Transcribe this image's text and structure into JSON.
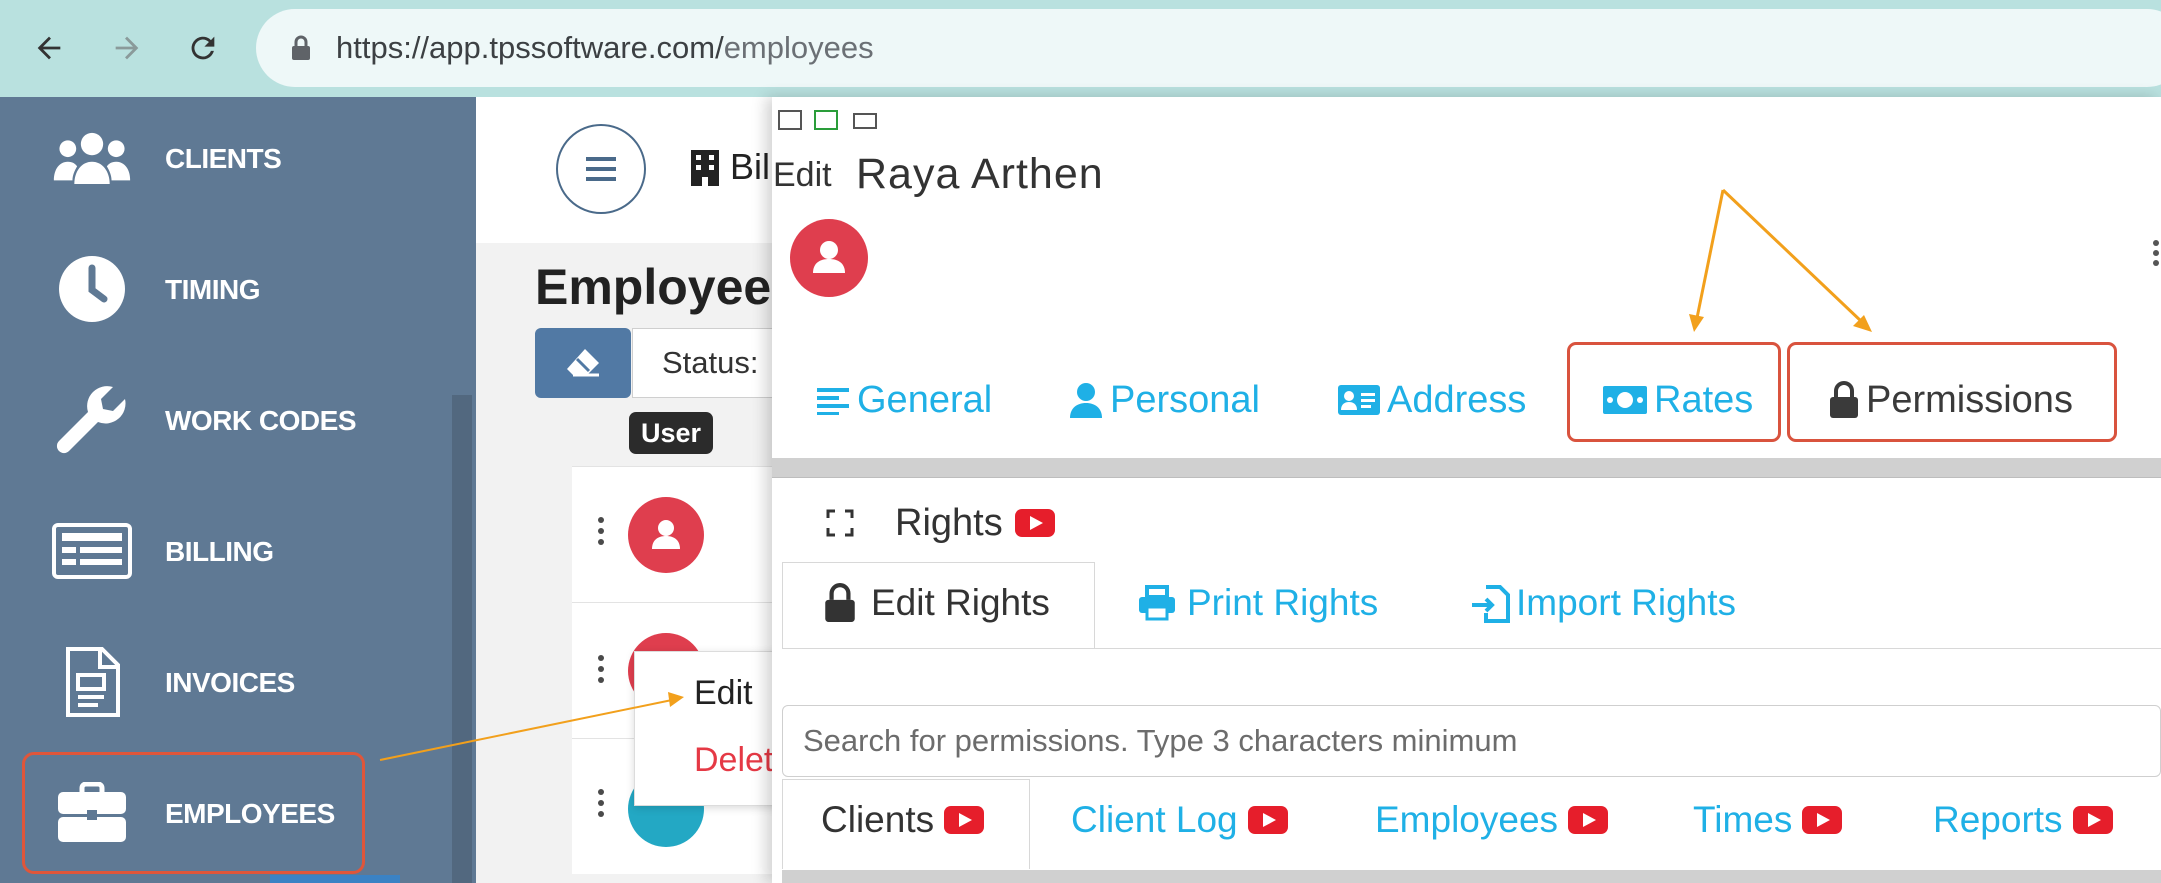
{
  "browser": {
    "url_host": "https://app.tpssoftware.com/",
    "url_path": "employees"
  },
  "sidebar": {
    "items": [
      {
        "label": "CLIENTS",
        "icon": "users-icon"
      },
      {
        "label": "TIMING",
        "icon": "clock-icon"
      },
      {
        "label": "WORK CODES",
        "icon": "wrench-icon"
      },
      {
        "label": "BILLING",
        "icon": "billing-list-icon"
      },
      {
        "label": "INVOICES",
        "icon": "invoice-icon"
      },
      {
        "label": "EMPLOYEES",
        "icon": "briefcase-icon"
      }
    ]
  },
  "main": {
    "header_partial": "Bil",
    "page_title_partial": "Employees",
    "status_label": "Status:",
    "user_badge": "User",
    "context_menu": {
      "edit": "Edit",
      "delete": "Delete"
    }
  },
  "dialog": {
    "title_prefix": "Edit",
    "employee_name": "Raya Arthen",
    "tabs": [
      {
        "label": "General",
        "icon": "align-left-icon"
      },
      {
        "label": "Personal",
        "icon": "user-icon"
      },
      {
        "label": "Address",
        "icon": "address-card-icon"
      },
      {
        "label": "Rates",
        "icon": "money-bill-icon"
      },
      {
        "label": "Permissions",
        "icon": "lock-icon"
      }
    ],
    "rights_title": "Rights",
    "rights_tabs": [
      {
        "label": "Edit Rights",
        "icon": "lock-icon"
      },
      {
        "label": "Print Rights",
        "icon": "print-icon"
      },
      {
        "label": "Import Rights",
        "icon": "import-icon"
      }
    ],
    "search_placeholder": "Search for permissions. Type 3 characters minimum",
    "category_tabs": [
      "Clients",
      "Client Log",
      "Employees",
      "Times",
      "Reports"
    ]
  },
  "colors": {
    "accent_blue": "#1fb0e6",
    "highlight_red": "#d9533e",
    "arrow_orange": "#f2a01c",
    "avatar_red": "#df3e4e",
    "sidebar_bg": "#5f7994"
  }
}
